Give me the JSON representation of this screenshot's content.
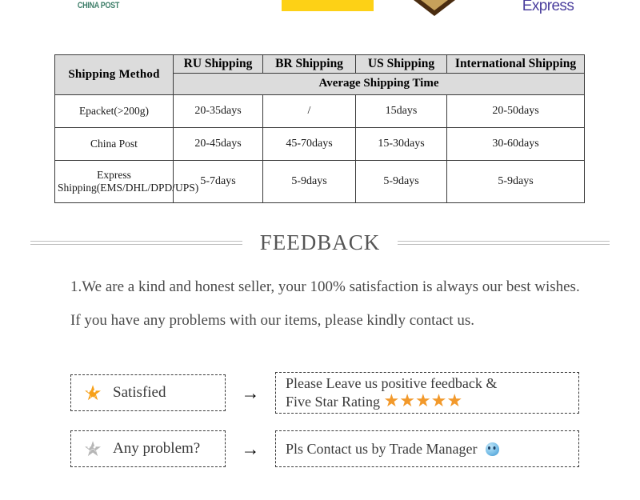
{
  "logos": {
    "china_post_label": "CHINA POST",
    "dhl_label": "dhl-yellow-bar-logo",
    "ems_label": "ems-hat-logo",
    "express_label": "Express",
    "yellow": "#fdd116",
    "green": "#3f7f6a",
    "purple": "#4b3f9e",
    "hat_brown": "#4a2c10"
  },
  "shipping_table": {
    "headers": [
      "Shipping  Method",
      "RU Shipping",
      "BR Shipping",
      "US Shipping",
      "International Shipping"
    ],
    "subheader": "Average Shipping Time",
    "rows": [
      {
        "method": "Epacket(>200g)",
        "ru": "20-35days",
        "br": "/",
        "us": "15days",
        "intl": "20-50days"
      },
      {
        "method": "China Post",
        "ru": "20-45days",
        "br": "45-70days",
        "us": "15-30days",
        "intl": "30-60days"
      },
      {
        "method": "Express Shipping(EMS/DHL/DPD/UPS)",
        "ru": "5-7days",
        "br": "5-9days",
        "us": "5-9days",
        "intl": "5-9days"
      }
    ],
    "header_bg": "#dcdcdc",
    "border_color": "#3a3a3a"
  },
  "feedback": {
    "heading": "FEEDBACK",
    "paragraph": "1.We are a kind and honest seller, your 100% satisfaction is always our best wishes. If you have any problems with our items, please kindly contact us.",
    "rows": [
      {
        "left_label": "Satisfied",
        "left_icon": "happy-star-icon",
        "arrow": "→",
        "right_line1": "Please Leave us positive feedback &",
        "right_line2": "Five Star Rating",
        "right_stars": "★★★★★",
        "right_icon": ""
      },
      {
        "left_label": "Any problem?",
        "left_icon": "sad-star-icon",
        "arrow": "→",
        "right_line1": "Pls Contact us by Trade Manager",
        "right_line2": "",
        "right_stars": "",
        "right_icon": "trade-manager-icon"
      }
    ],
    "star_color": "#f2992b",
    "sad_star_color": "#b6b6b6",
    "heading_color": "#555555"
  }
}
